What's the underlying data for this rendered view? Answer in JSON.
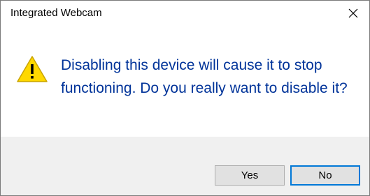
{
  "window": {
    "title": "Integrated Webcam",
    "close_icon": "close-icon"
  },
  "dialog": {
    "icon": "warning-icon",
    "message": "Disabling this device will cause it to stop functioning. Do you really want to disable it?"
  },
  "buttons": {
    "yes_label": "Yes",
    "no_label": "No",
    "default": "No"
  },
  "colors": {
    "message_text": "#003399",
    "footer_bg": "#f0f0f0",
    "button_bg": "#e1e1e1",
    "focus_border": "#0078d7",
    "warning_fill": "#ffd800"
  }
}
